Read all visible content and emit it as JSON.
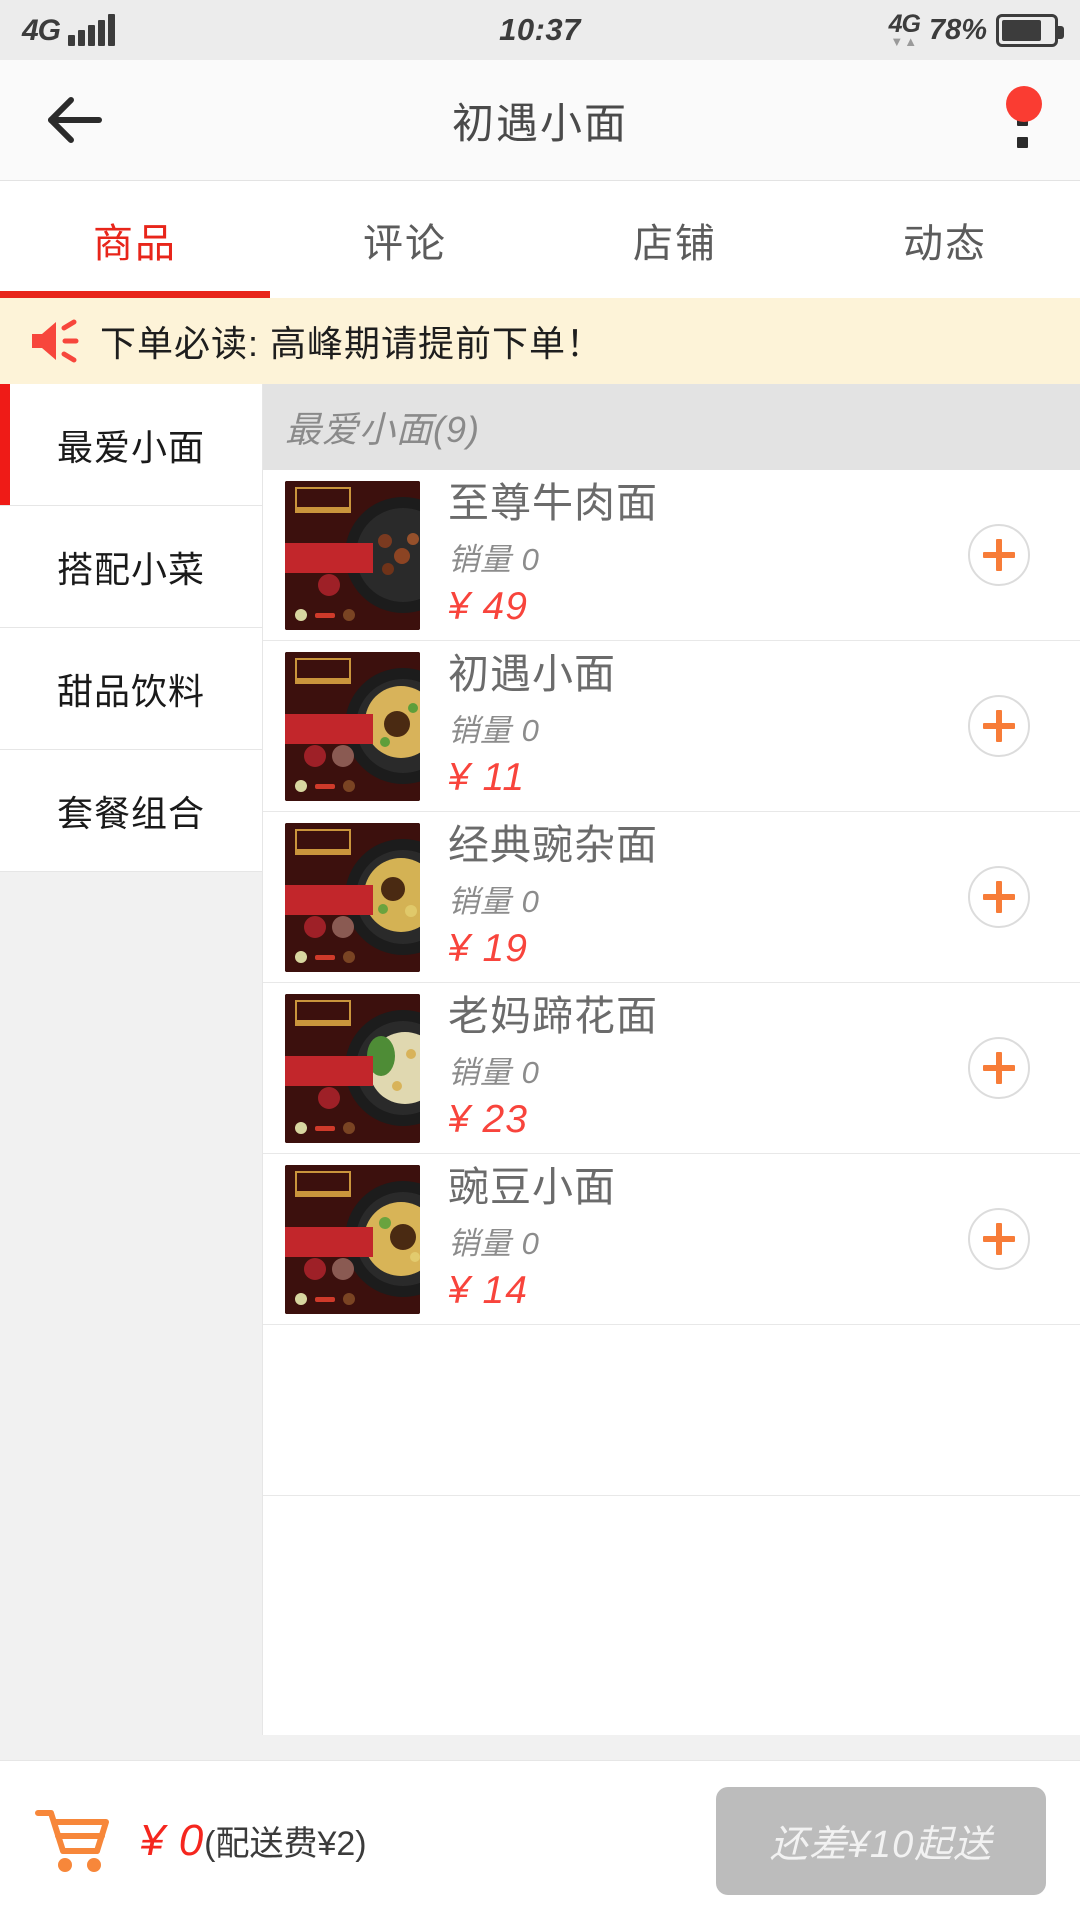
{
  "status_bar": {
    "network_left": "4G",
    "time": "10:37",
    "network_right": "4G",
    "data_arrows": "▼▲",
    "battery_percent": "78%"
  },
  "nav": {
    "back_icon": "back-arrow-icon",
    "title": "初遇小面",
    "menu_icon": "overflow-menu-icon",
    "badge": ""
  },
  "tabs": [
    {
      "label": "商品",
      "active": true
    },
    {
      "label": "评论",
      "active": false
    },
    {
      "label": "店铺",
      "active": false
    },
    {
      "label": "动态",
      "active": false
    }
  ],
  "notice": {
    "icon": "megaphone-icon",
    "text": "下单必读: 高峰期请提前下单！"
  },
  "sidebar": {
    "items": [
      {
        "label": "最爱小面",
        "active": true
      },
      {
        "label": "搭配小菜",
        "active": false
      },
      {
        "label": "甜品饮料",
        "active": false
      },
      {
        "label": "套餐组合",
        "active": false
      }
    ]
  },
  "menu": {
    "section_title": "最爱小面(9)",
    "sales_label": "销量",
    "currency": "¥",
    "items": [
      {
        "name": "至尊牛肉面",
        "sales": "销量 0",
        "price": "¥ 49",
        "thumb_label": "至尊牛肉面",
        "thumb_kind": "beef"
      },
      {
        "name": "初遇小面",
        "sales": "销量 0",
        "price": "¥ 11",
        "thumb_label": "初遇小面",
        "thumb_kind": "noodle"
      },
      {
        "name": "经典豌杂面",
        "sales": "销量 0",
        "price": "¥ 19",
        "thumb_label": "经典豌杂面",
        "thumb_kind": "pea"
      },
      {
        "name": "老妈蹄花面",
        "sales": "销量 0",
        "price": "¥ 23",
        "thumb_label": "老妈蹄花面",
        "thumb_kind": "trotter"
      },
      {
        "name": "豌豆小面",
        "sales": "销量 0",
        "price": "¥ 14",
        "thumb_label": "豌豆小面",
        "thumb_kind": "pea"
      }
    ],
    "brand_logo_text": "初遇小面"
  },
  "cart": {
    "icon": "shopping-cart-icon",
    "amount": "¥ 0",
    "fee_note": "(配送费¥2)",
    "checkout_label": "还差¥10起送",
    "checkout_enabled": false
  },
  "colors": {
    "accent_red": "#e8251a",
    "price_red": "#f8443c",
    "add_orange": "#f77c38",
    "notice_bg": "#fdf3d8",
    "disabled_gray": "#bcbcbc"
  }
}
